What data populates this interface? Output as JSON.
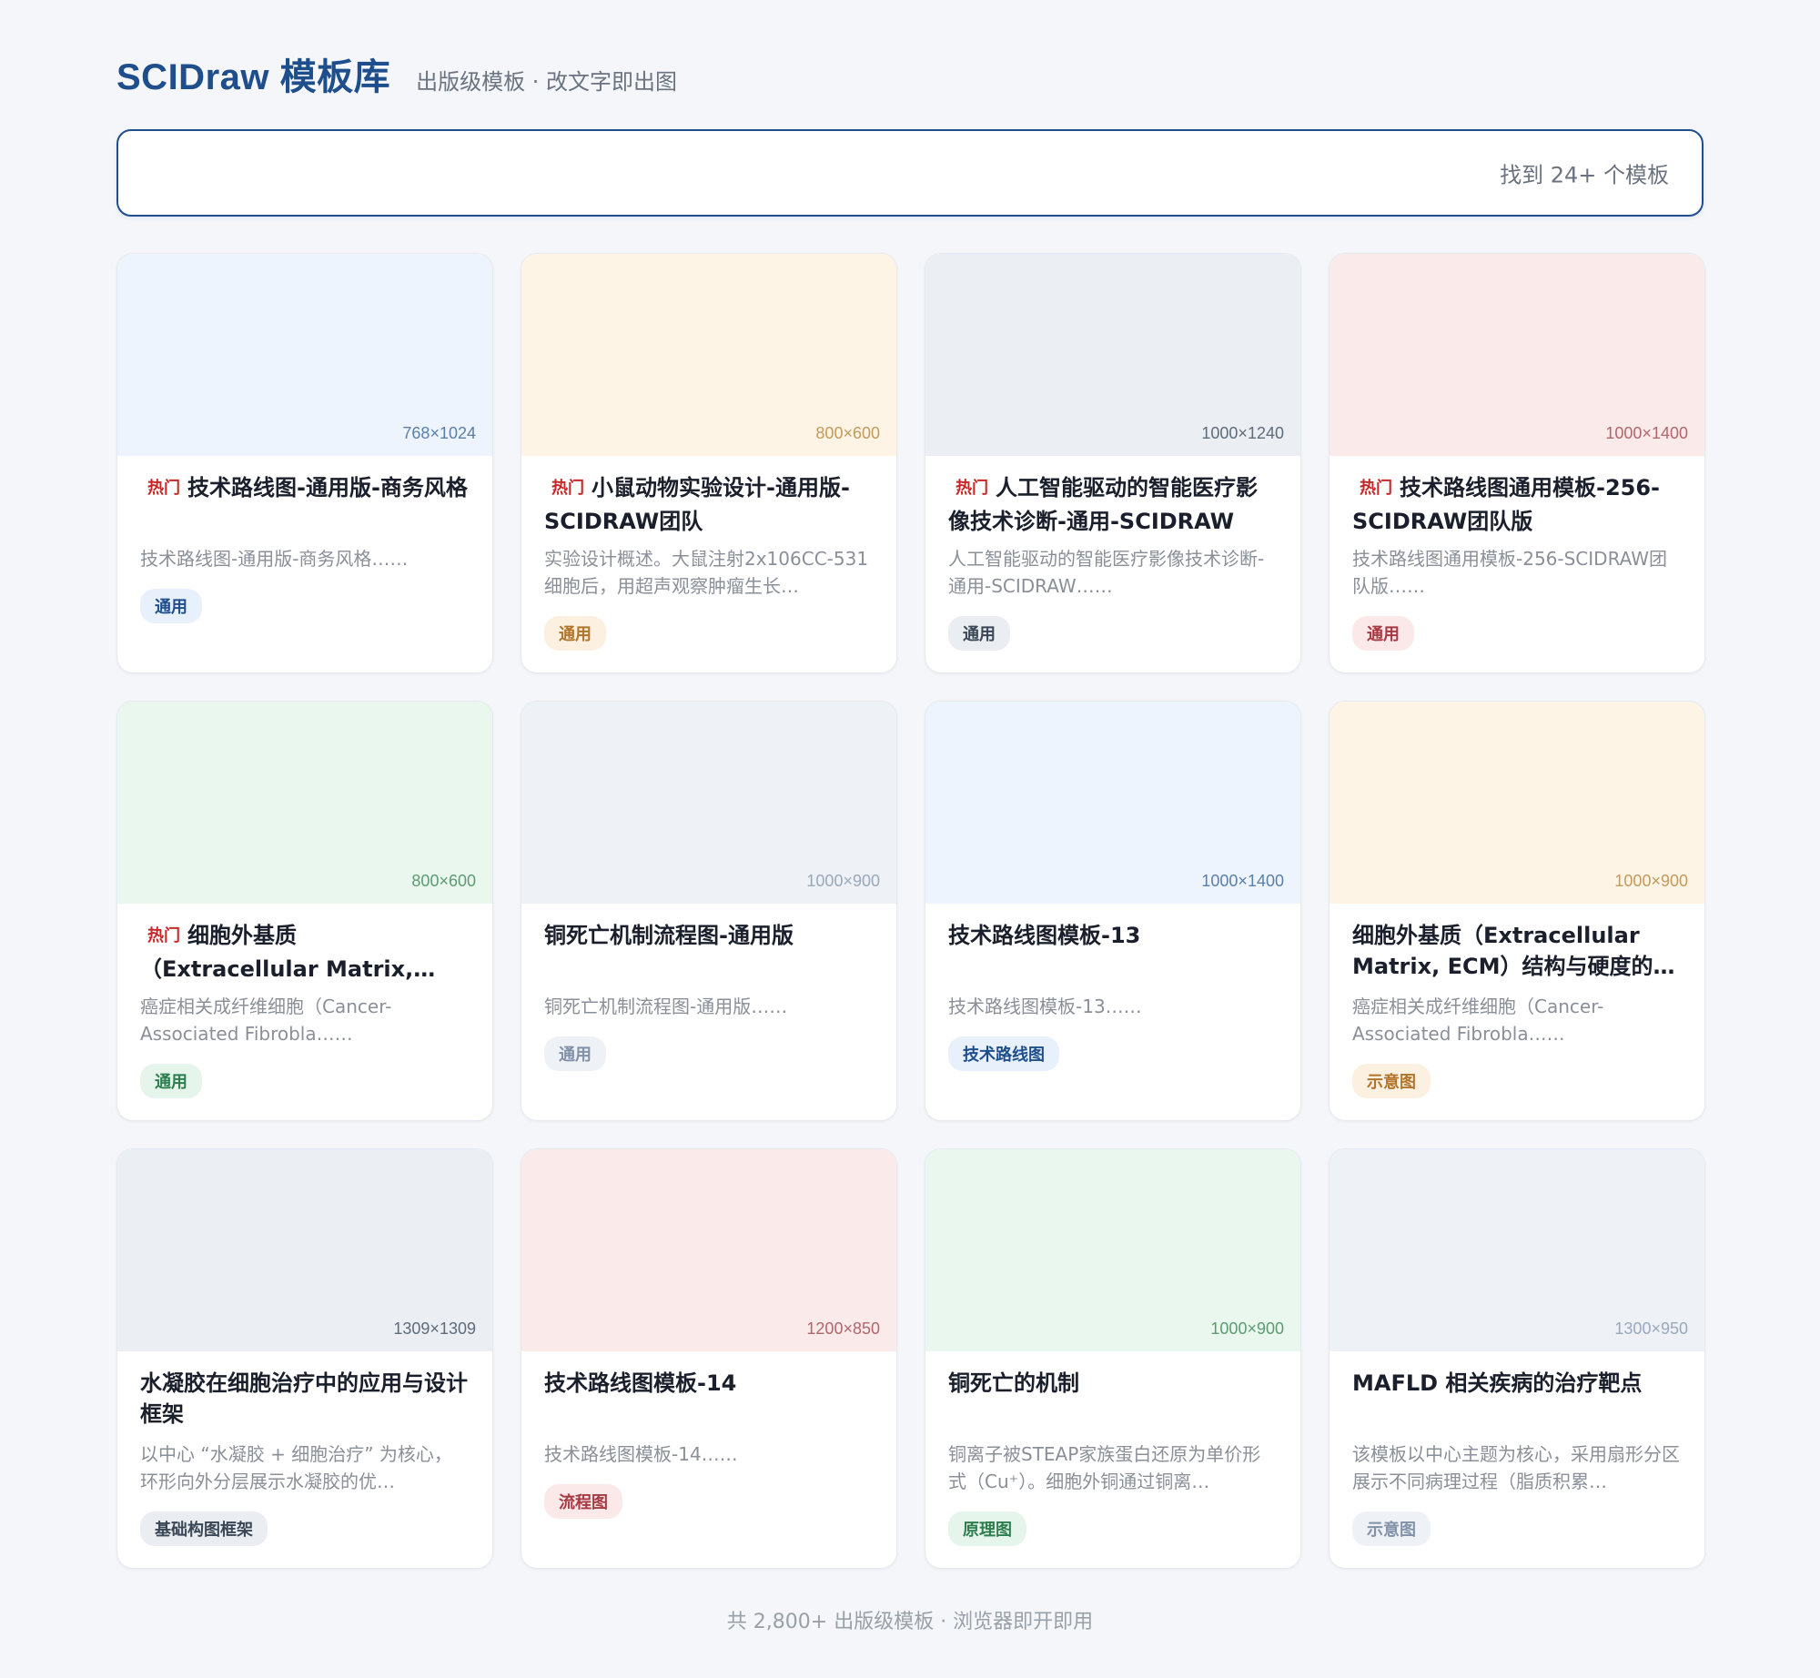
{
  "header": {
    "brand": "SCIDraw 模板库",
    "tagline": "出版级模板 · 改文字即出图"
  },
  "search": {
    "placeholder": "",
    "result_count": "找到 24+ 个模板"
  },
  "cards": [
    {
      "dims": "768×1024",
      "hot": "热门",
      "title": "技术路线图-通用版-商务风格",
      "desc": "技术路线图-通用版-商务风格……",
      "tag": "通用"
    },
    {
      "dims": "800×600",
      "hot": "热门",
      "title": "小鼠动物实验设计-通用版-SCIDRAW团队",
      "desc": "实验设计概述。大鼠注射2x106CC-531细胞后，用超声观察肿瘤生长…",
      "tag": "通用"
    },
    {
      "dims": "1000×1240",
      "hot": "热门",
      "title": "人工智能驱动的智能医疗影像技术诊断-通用-SCIDRAW",
      "desc": "人工智能驱动的智能医疗影像技术诊断-通用-SCIDRAW……",
      "tag": "通用"
    },
    {
      "dims": "1000×1400",
      "hot": "热门",
      "title": "技术路线图通用模板-256-SCIDRAW团队版",
      "desc": "技术路线图通用模板-256-SCIDRAW团队版……",
      "tag": "通用"
    },
    {
      "dims": "800×600",
      "hot": "热门",
      "title": "细胞外基质（Extracellular Matrix,…",
      "desc": "癌症相关成纤维细胞（Cancer-Associated Fibrobla……",
      "tag": "通用"
    },
    {
      "dims": "1000×900",
      "hot": "",
      "title": "铜死亡机制流程图-通用版",
      "desc": "铜死亡机制流程图-通用版……",
      "tag": "通用"
    },
    {
      "dims": "1000×1400",
      "hot": "",
      "title": "技术路线图模板-13",
      "desc": "技术路线图模板-13……",
      "tag": "技术路线图"
    },
    {
      "dims": "1000×900",
      "hot": "",
      "title": "细胞外基质（Extracellular Matrix, ECM）结构与硬度的…",
      "desc": "癌症相关成纤维细胞（Cancer-Associated Fibrobla……",
      "tag": "示意图"
    },
    {
      "dims": "1309×1309",
      "hot": "",
      "title": "水凝胶在细胞治疗中的应用与设计框架",
      "desc": "以中心 “水凝胶 + 细胞治疗” 为核心，环形向外分层展示水凝胶的优…",
      "tag": "基础构图框架"
    },
    {
      "dims": "1200×850",
      "hot": "",
      "title": "技术路线图模板-14",
      "desc": "技术路线图模板-14……",
      "tag": "流程图"
    },
    {
      "dims": "1000×900",
      "hot": "",
      "title": "铜死亡的机制",
      "desc": "铜离子被STEAP家族蛋白还原为单价形式（Cu⁺）。细胞外铜通过铜离…",
      "tag": "原理图"
    },
    {
      "dims": "1300×950",
      "hot": "",
      "title": "MAFLD 相关疾病的治疗靶点",
      "desc": "该模板以中心主题为核心，采用扇形分区展示不同病理过程（脂质积累…",
      "tag": "示意图"
    }
  ],
  "themes": {
    "blue": {
      "bg": "#eef4fd",
      "dims": "#5a7fa8",
      "tag_bg": "#e8f0fb",
      "tag_fg": "#1f4e8c"
    },
    "amber": {
      "bg": "#fdf4e6",
      "dims": "#c49a5c",
      "tag_bg": "#fcf1e0",
      "tag_fg": "#b0742a"
    },
    "slate": {
      "bg": "#ebeff3",
      "dims": "#5f6b78",
      "tag_bg": "#eaedf1",
      "tag_fg": "#3b4756"
    },
    "rose": {
      "bg": "#faeaea",
      "dims": "#b0666c",
      "tag_bg": "#fbe9ea",
      "tag_fg": "#a63a43"
    },
    "green": {
      "bg": "#e9f7ee",
      "dims": "#5d9a72",
      "tag_bg": "#e6f5ec",
      "tag_fg": "#2e7d4f"
    },
    "gray": {
      "bg": "#eef1f5",
      "dims": "#9aa8bb",
      "tag_bg": "#eef1f5",
      "tag_fg": "#8191a8"
    }
  },
  "card_themes": [
    "blue",
    "amber",
    "slate",
    "rose",
    "green",
    "gray",
    "blue",
    "amber",
    "slate",
    "rose",
    "green",
    "gray"
  ],
  "footer": {
    "text": "共 2,800+ 出版级模板 · 浏览器即开即用"
  }
}
